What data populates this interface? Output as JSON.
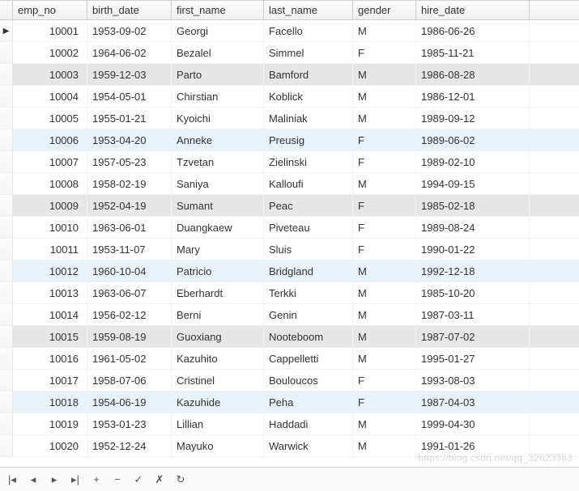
{
  "columns": [
    {
      "key": "emp_no",
      "label": "emp_no"
    },
    {
      "key": "birth_date",
      "label": "birth_date"
    },
    {
      "key": "first_name",
      "label": "first_name"
    },
    {
      "key": "last_name",
      "label": "last_name"
    },
    {
      "key": "gender",
      "label": "gender"
    },
    {
      "key": "hire_date",
      "label": "hire_date"
    }
  ],
  "rows": [
    {
      "emp_no": "10001",
      "birth_date": "1953-09-02",
      "first_name": "Georgi",
      "last_name": "Facello",
      "gender": "M",
      "hire_date": "1986-06-26",
      "current": true
    },
    {
      "emp_no": "10002",
      "birth_date": "1964-06-02",
      "first_name": "Bezalel",
      "last_name": "Simmel",
      "gender": "F",
      "hire_date": "1985-11-21"
    },
    {
      "emp_no": "10003",
      "birth_date": "1959-12-03",
      "first_name": "Parto",
      "last_name": "Bamford",
      "gender": "M",
      "hire_date": "1986-08-28",
      "highlight": "grey"
    },
    {
      "emp_no": "10004",
      "birth_date": "1954-05-01",
      "first_name": "Chirstian",
      "last_name": "Koblick",
      "gender": "M",
      "hire_date": "1986-12-01"
    },
    {
      "emp_no": "10005",
      "birth_date": "1955-01-21",
      "first_name": "Kyoichi",
      "last_name": "Maliniak",
      "gender": "M",
      "hire_date": "1989-09-12"
    },
    {
      "emp_no": "10006",
      "birth_date": "1953-04-20",
      "first_name": "Anneke",
      "last_name": "Preusig",
      "gender": "F",
      "hire_date": "1989-06-02",
      "highlight": "blue"
    },
    {
      "emp_no": "10007",
      "birth_date": "1957-05-23",
      "first_name": "Tzvetan",
      "last_name": "Zielinski",
      "gender": "F",
      "hire_date": "1989-02-10"
    },
    {
      "emp_no": "10008",
      "birth_date": "1958-02-19",
      "first_name": "Saniya",
      "last_name": "Kalloufi",
      "gender": "M",
      "hire_date": "1994-09-15"
    },
    {
      "emp_no": "10009",
      "birth_date": "1952-04-19",
      "first_name": "Sumant",
      "last_name": "Peac",
      "gender": "F",
      "hire_date": "1985-02-18",
      "highlight": "grey"
    },
    {
      "emp_no": "10010",
      "birth_date": "1963-06-01",
      "first_name": "Duangkaew",
      "last_name": "Piveteau",
      "gender": "F",
      "hire_date": "1989-08-24"
    },
    {
      "emp_no": "10011",
      "birth_date": "1953-11-07",
      "first_name": "Mary",
      "last_name": "Sluis",
      "gender": "F",
      "hire_date": "1990-01-22"
    },
    {
      "emp_no": "10012",
      "birth_date": "1960-10-04",
      "first_name": "Patricio",
      "last_name": "Bridgland",
      "gender": "M",
      "hire_date": "1992-12-18",
      "highlight": "blue"
    },
    {
      "emp_no": "10013",
      "birth_date": "1963-06-07",
      "first_name": "Eberhardt",
      "last_name": "Terkki",
      "gender": "M",
      "hire_date": "1985-10-20"
    },
    {
      "emp_no": "10014",
      "birth_date": "1956-02-12",
      "first_name": "Berni",
      "last_name": "Genin",
      "gender": "M",
      "hire_date": "1987-03-11"
    },
    {
      "emp_no": "10015",
      "birth_date": "1959-08-19",
      "first_name": "Guoxiang",
      "last_name": "Nooteboom",
      "gender": "M",
      "hire_date": "1987-07-02",
      "highlight": "grey"
    },
    {
      "emp_no": "10016",
      "birth_date": "1961-05-02",
      "first_name": "Kazuhito",
      "last_name": "Cappelletti",
      "gender": "M",
      "hire_date": "1995-01-27"
    },
    {
      "emp_no": "10017",
      "birth_date": "1958-07-06",
      "first_name": "Cristinel",
      "last_name": "Bouloucos",
      "gender": "F",
      "hire_date": "1993-08-03"
    },
    {
      "emp_no": "10018",
      "birth_date": "1954-06-19",
      "first_name": "Kazuhide",
      "last_name": "Peha",
      "gender": "F",
      "hire_date": "1987-04-03",
      "highlight": "blue"
    },
    {
      "emp_no": "10019",
      "birth_date": "1953-01-23",
      "first_name": "Lillian",
      "last_name": "Haddadi",
      "gender": "M",
      "hire_date": "1999-04-30"
    },
    {
      "emp_no": "10020",
      "birth_date": "1952-12-24",
      "first_name": "Mayuko",
      "last_name": "Warwick",
      "gender": "M",
      "hire_date": "1991-01-26"
    }
  ],
  "toolbar": {
    "first": "|◂",
    "prev": "◂",
    "next": "▸",
    "last": "▸|",
    "add": "+",
    "delete": "−",
    "commit": "✓",
    "cancel": "✗",
    "refresh": "↻"
  },
  "watermark": "https://blog.csdn.net/qq_32623363"
}
